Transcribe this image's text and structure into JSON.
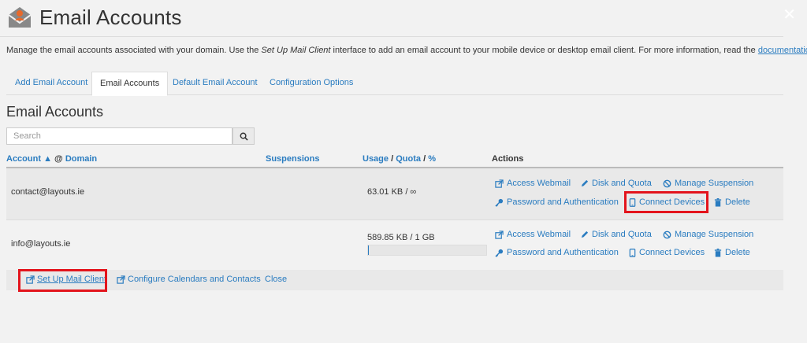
{
  "header": {
    "title": "Email Accounts"
  },
  "intro": {
    "before": "Manage the email accounts associated with your domain. Use the ",
    "em": "Set Up Mail Client",
    "middle": " interface to add an email account to your mobile device or desktop email client. For more information, read the ",
    "link": "documentation",
    "after": "."
  },
  "tabs": [
    {
      "label": "Add Email Account"
    },
    {
      "label": "Email Accounts"
    },
    {
      "label": "Default Email Account"
    },
    {
      "label": "Configuration Options"
    }
  ],
  "section_title": "Email Accounts",
  "search": {
    "placeholder": "Search"
  },
  "table": {
    "headers": {
      "account": "Account",
      "sort_arrow": "▲",
      "at": "@",
      "domain": "Domain",
      "suspensions": "Suspensions",
      "usage": "Usage",
      "slash1": "/",
      "quota": "Quota",
      "slash2": "/",
      "percent": "%",
      "actions": "Actions"
    },
    "rows": [
      {
        "email": "contact@layouts.ie",
        "usage": "63.01 KB / ∞"
      },
      {
        "email": "info@layouts.ie",
        "usage": "589.85 KB / 1 GB",
        "usage_fraction": 0.0006
      }
    ],
    "actions": {
      "webmail": "Access Webmail",
      "disk": "Disk and Quota",
      "suspension": "Manage Suspension",
      "password": "Password and Authentication",
      "connect": "Connect Devices",
      "delete": "Delete"
    }
  },
  "footer": {
    "setup": "Set Up Mail Client",
    "calendars": "Configure Calendars and Contacts",
    "close": "Close"
  },
  "colors": {
    "link": "#2a7cc0",
    "highlight": "#e3141c",
    "logo_orange": "#e8692a"
  },
  "icons": [
    "email-logo-icon",
    "search-icon",
    "external-link-icon",
    "pencil-icon",
    "ban-icon",
    "key-icon",
    "mobile-icon",
    "trash-icon",
    "close-icon"
  ]
}
